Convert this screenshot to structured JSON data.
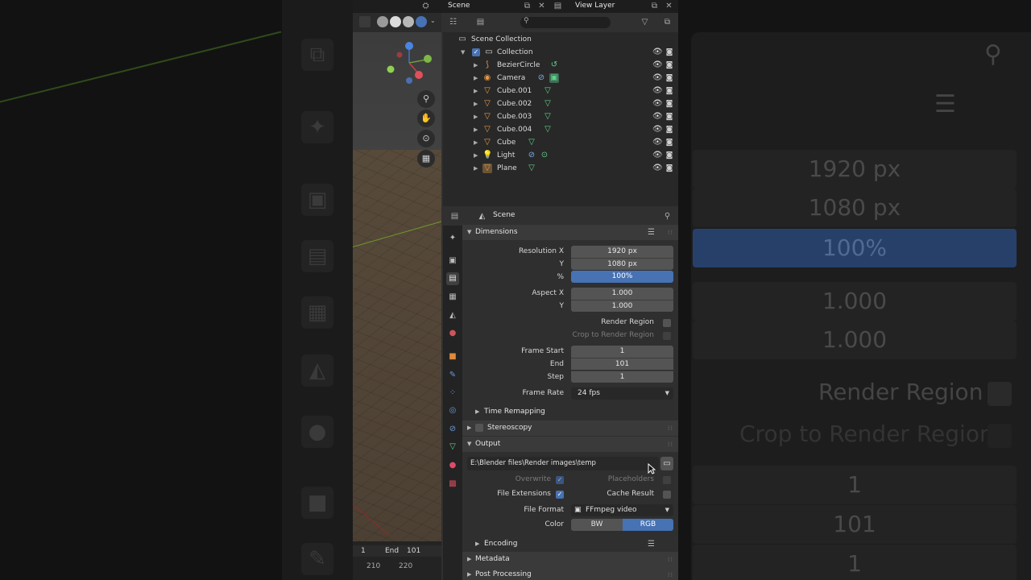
{
  "topbar": {
    "scene_name": "Scene",
    "view_layer_name": "View Layer"
  },
  "viewport": {
    "timeline_current_frame": "1",
    "timeline_end_label": "End",
    "timeline_end_value": "101",
    "ruler_ticks": [
      "210",
      "220"
    ]
  },
  "outliner": {
    "search_placeholder": "",
    "root_label": "Scene Collection",
    "collection_label": "Collection",
    "objects": [
      {
        "name": "BezierCircle"
      },
      {
        "name": "Camera"
      },
      {
        "name": "Cube.001"
      },
      {
        "name": "Cube.002"
      },
      {
        "name": "Cube.003"
      },
      {
        "name": "Cube.004"
      },
      {
        "name": "Cube"
      },
      {
        "name": "Light"
      },
      {
        "name": "Plane"
      }
    ]
  },
  "properties": {
    "context_label": "Scene",
    "dimensions": {
      "title": "Dimensions",
      "resolution_x_label": "Resolution X",
      "resolution_x": "1920 px",
      "resolution_y_label": "Y",
      "resolution_y": "1080 px",
      "resolution_pct_label": "%",
      "resolution_pct": "100%",
      "aspect_x_label": "Aspect X",
      "aspect_x": "1.000",
      "aspect_y_label": "Y",
      "aspect_y": "1.000",
      "render_region_label": "Render Region",
      "crop_label": "Crop to Render Region",
      "frame_start_label": "Frame Start",
      "frame_start": "1",
      "frame_end_label": "End",
      "frame_end": "101",
      "frame_step_label": "Step",
      "frame_step": "1",
      "frame_rate_label": "Frame Rate",
      "frame_rate": "24 fps",
      "time_remapping": "Time Remapping"
    },
    "stereoscopy_title": "Stereoscopy",
    "output": {
      "title": "Output",
      "path": "E:\\Blender files\\Render images\\temp",
      "overwrite_label": "Overwrite",
      "placeholders_label": "Placeholders",
      "file_extensions_label": "File Extensions",
      "cache_result_label": "Cache Result",
      "file_format_label": "File Format",
      "file_format": "FFmpeg video",
      "color_label": "Color",
      "color_options": [
        "BW",
        "RGB"
      ],
      "encoding_label": "Encoding"
    },
    "metadata_title": "Metadata",
    "post_processing_title": "Post Processing"
  },
  "background": {
    "fields": [
      "1920 px",
      "1080 px",
      "100%",
      "1.000",
      "1.000"
    ],
    "render_region": "Render Region",
    "crop": "Crop to Render Region",
    "frames": [
      "1",
      "101",
      "1"
    ]
  },
  "colors": {
    "accent_blue": "#4772b3",
    "panel_bg": "#2f2f2f",
    "object_orange": "#e69a4a",
    "mesh_green": "#5fd28a"
  }
}
